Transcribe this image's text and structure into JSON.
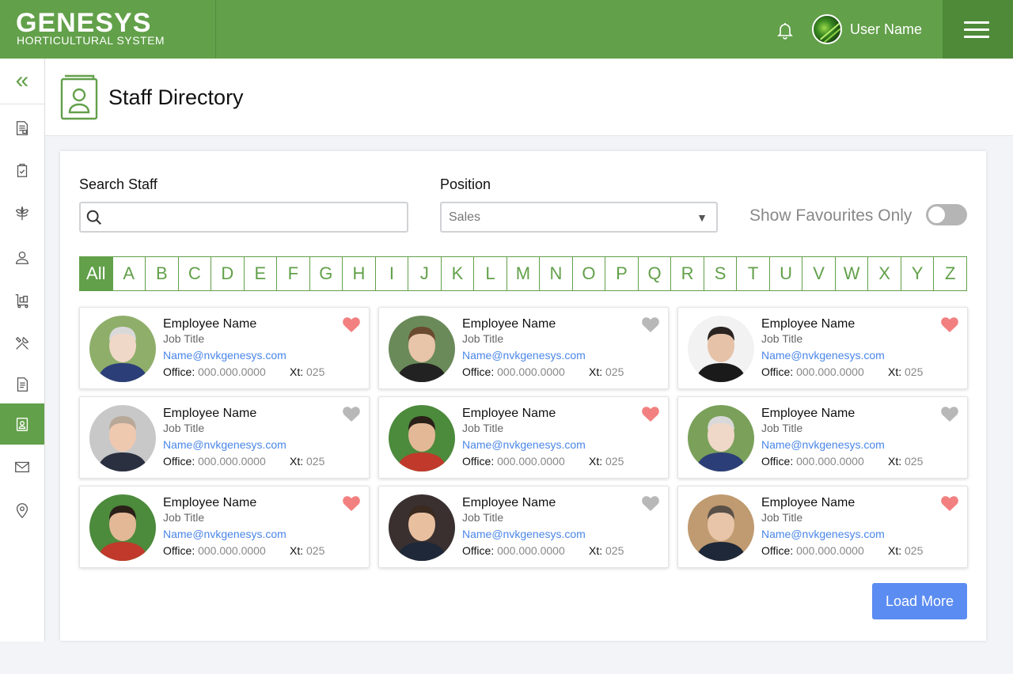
{
  "header": {
    "brand": "GENESYS",
    "brand_sub": "HORTICULTURAL SYSTEM",
    "user_name": "User Name"
  },
  "page": {
    "title": "Staff Directory"
  },
  "filters": {
    "search_label": "Search Staff",
    "search_value": "",
    "position_label": "Position",
    "position_value": "Sales",
    "favourites_label": "Show Favourites Only",
    "favourites_on": false
  },
  "alphabet": [
    "All",
    "A",
    "B",
    "C",
    "D",
    "E",
    "F",
    "G",
    "H",
    "I",
    "J",
    "K",
    "L",
    "M",
    "N",
    "O",
    "P",
    "Q",
    "R",
    "S",
    "T",
    "U",
    "V",
    "W",
    "X",
    "Y",
    "Z"
  ],
  "employees": [
    {
      "name": "Employee Name",
      "job": "Job Title",
      "email": "Name@nvkgenesys.com",
      "office_label": "Office:",
      "office": "000.000.0000",
      "xt_label": "Xt:",
      "xt": "025",
      "favourite": true
    },
    {
      "name": "Employee Name",
      "job": "Job Title",
      "email": "Name@nvkgenesys.com",
      "office_label": "Office:",
      "office": "000.000.0000",
      "xt_label": "Xt:",
      "xt": "025",
      "favourite": false
    },
    {
      "name": "Employee Name",
      "job": "Job Title",
      "email": "Name@nvkgenesys.com",
      "office_label": "Office:",
      "office": "000.000.0000",
      "xt_label": "Xt:",
      "xt": "025",
      "favourite": true
    },
    {
      "name": "Employee Name",
      "job": "Job Title",
      "email": "Name@nvkgenesys.com",
      "office_label": "Office:",
      "office": "000.000.0000",
      "xt_label": "Xt:",
      "xt": "025",
      "favourite": false
    },
    {
      "name": "Employee Name",
      "job": "Job Title",
      "email": "Name@nvkgenesys.com",
      "office_label": "Office:",
      "office": "000.000.0000",
      "xt_label": "Xt:",
      "xt": "025",
      "favourite": true
    },
    {
      "name": "Employee Name",
      "job": "Job Title",
      "email": "Name@nvkgenesys.com",
      "office_label": "Office:",
      "office": "000.000.0000",
      "xt_label": "Xt:",
      "xt": "025",
      "favourite": false
    },
    {
      "name": "Employee Name",
      "job": "Job Title",
      "email": "Name@nvkgenesys.com",
      "office_label": "Office:",
      "office": "000.000.0000",
      "xt_label": "Xt:",
      "xt": "025",
      "favourite": true
    },
    {
      "name": "Employee Name",
      "job": "Job Title",
      "email": "Name@nvkgenesys.com",
      "office_label": "Office:",
      "office": "000.000.0000",
      "xt_label": "Xt:",
      "xt": "025",
      "favourite": false
    },
    {
      "name": "Employee Name",
      "job": "Job Title",
      "email": "Name@nvkgenesys.com",
      "office_label": "Office:",
      "office": "000.000.0000",
      "xt_label": "Xt:",
      "xt": "025",
      "favourite": true
    }
  ],
  "load_more_label": "Load More",
  "colors": {
    "brand_green": "#62a04a",
    "header_dark": "#4f8a39",
    "heart_on": "#f28080",
    "heart_off": "#b8b8b8",
    "link_blue": "#4a86e8",
    "button_blue": "#5b8cf2"
  },
  "sidebar_icons": [
    "collapse-icon",
    "report-icon",
    "clipboard-icon",
    "plant-icon",
    "staff-icon",
    "cart-icon",
    "tools-icon",
    "document-icon",
    "directory-icon",
    "mail-icon",
    "location-icon"
  ]
}
